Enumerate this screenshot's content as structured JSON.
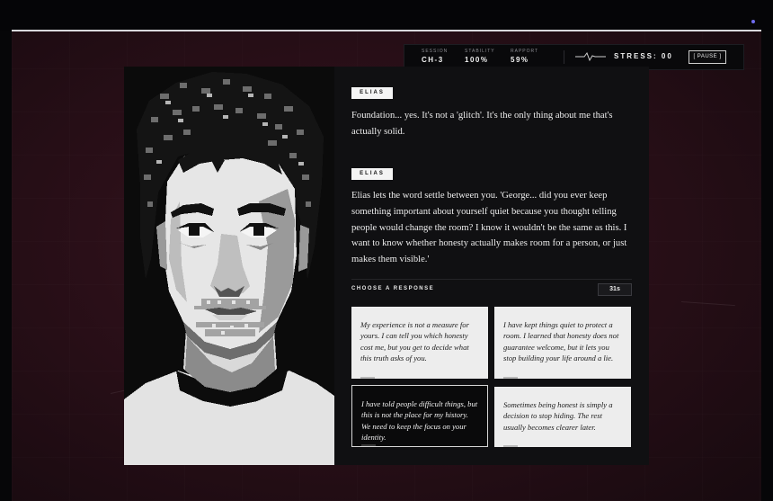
{
  "hud": {
    "session": {
      "label": "SESSION",
      "value": "CH-3"
    },
    "stability": {
      "label": "STABILITY",
      "value": "100%"
    },
    "rapport": {
      "label": "RAPPORT",
      "value": "59%"
    },
    "stress": "STRESS: 00",
    "pause_label": "[ PAUSE ]"
  },
  "dialog": {
    "entries": [
      {
        "speaker": "ELIAS",
        "text": "Foundation... yes. It's not a 'glitch'. It's the only thing about me that's actually solid."
      },
      {
        "speaker": "ELIAS",
        "text": "Elias lets the word settle between you. 'George... did you ever keep something important about yourself quiet because you thought telling people would change the room? I know it wouldn't be the same as this. I want to know whether honesty actually makes room for a person, or just makes them visible.'"
      }
    ],
    "choose_label": "CHOOSE A RESPONSE",
    "timer": "31s"
  },
  "choices": [
    {
      "text": "My experience is not a measure for yours. I can tell you which honesty cost me, but you get to decide what this truth asks of you."
    },
    {
      "text": "I have kept things quiet to protect a room. I learned that honesty does not guarantee welcome, but it lets you stop building your life around a lie."
    },
    {
      "text": "I have told people difficult things, but this is not the place for my history. We need to keep the focus on your identity."
    },
    {
      "text": "Sometimes being honest is simply a decision to stop hiding. The rest usually becomes clearer later."
    }
  ],
  "colors": {
    "accent": "#f4f4f4",
    "background": "#2a0f18",
    "panel": "#101012"
  }
}
